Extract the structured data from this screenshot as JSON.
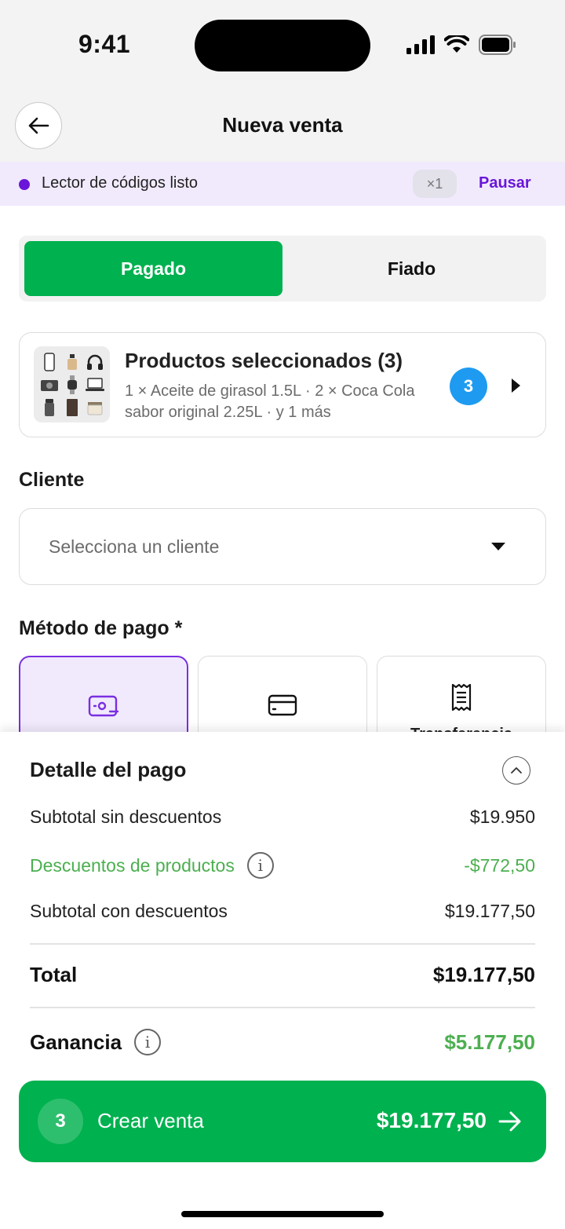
{
  "status_bar": {
    "time": "9:41"
  },
  "header": {
    "title": "Nueva venta"
  },
  "scanner": {
    "label": "Lector de códigos listo",
    "count": "×1",
    "pause_label": "Pausar"
  },
  "sale_type": {
    "paid_label": "Pagado",
    "credit_label": "Fiado",
    "selected": "Pagado"
  },
  "products": {
    "title": "Productos seleccionados (3)",
    "description": "1 × Aceite de girasol 1.5L · 2 × Coca Cola sabor original 2.25L · y 1 más",
    "badge": "3"
  },
  "client": {
    "label": "Cliente",
    "placeholder": "Selecciona un cliente"
  },
  "payment_method": {
    "label": "Método de pago *",
    "options": [
      {
        "icon": "cash-icon",
        "label": "",
        "selected": true
      },
      {
        "icon": "card-icon",
        "label": "",
        "selected": false
      },
      {
        "icon": "receipt-icon",
        "label": "Transferencia",
        "selected": false
      }
    ]
  },
  "payment_detail": {
    "title": "Detalle del pago",
    "subtotal_label": "Subtotal sin descuentos",
    "subtotal_value": "$19.950",
    "discount_label": "Descuentos de productos",
    "discount_value": "-$772,50",
    "subtotal_discounted_label": "Subtotal con descuentos",
    "subtotal_discounted_value": "$19.177,50",
    "total_label": "Total",
    "total_value": "$19.177,50",
    "profit_label": "Ganancia",
    "profit_value": "$5.177,50"
  },
  "cta": {
    "count": "3",
    "label": "Crear venta",
    "amount": "$19.177,50"
  },
  "colors": {
    "primary_green": "#00b14f",
    "accent_purple": "#6a16d9",
    "badge_blue": "#1e9bf0",
    "discount_green": "#4caf50"
  }
}
